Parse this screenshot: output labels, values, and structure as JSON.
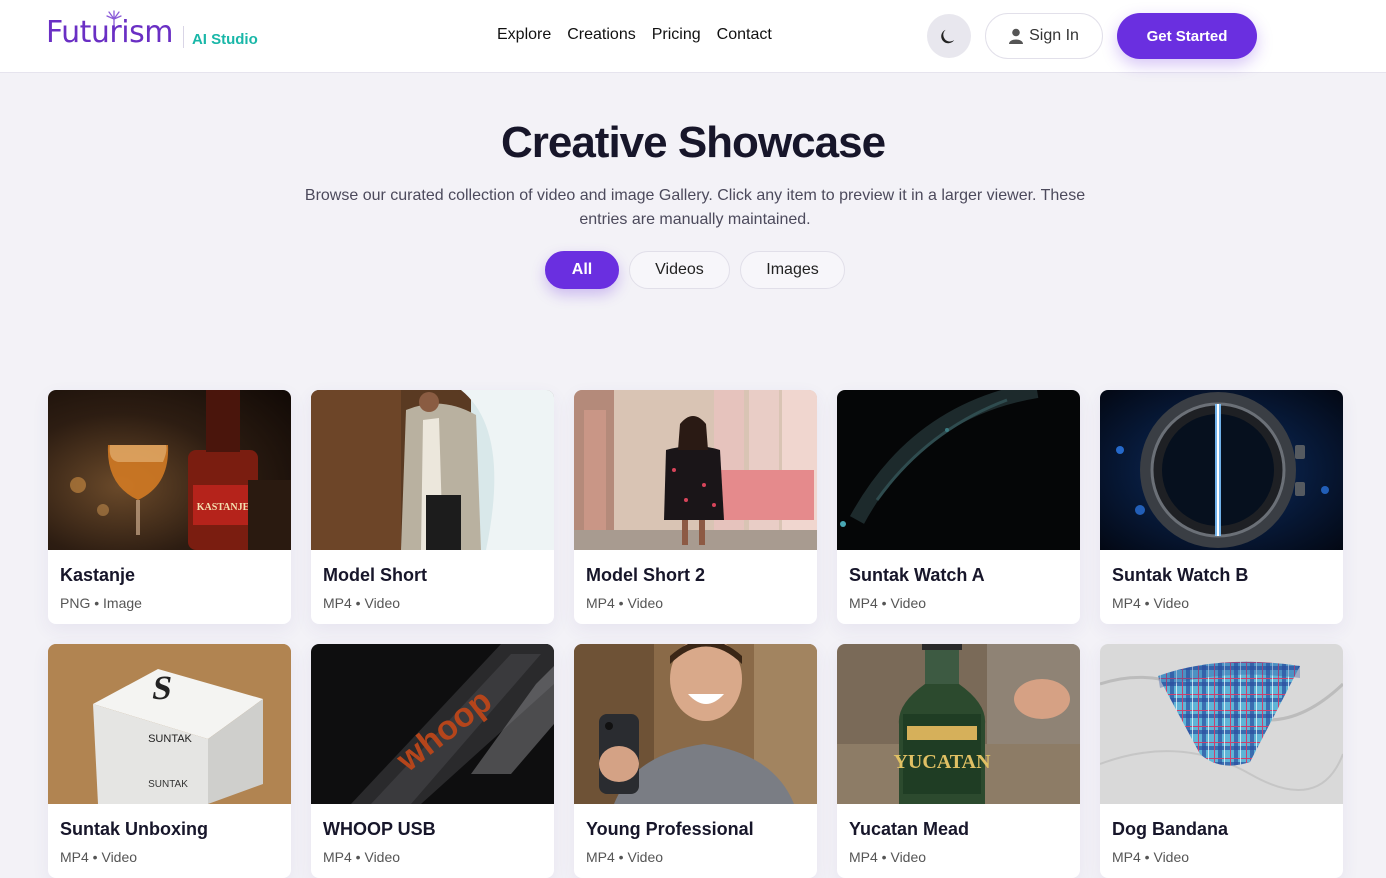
{
  "brand": {
    "name": "Futurism",
    "sub": "AI Studio"
  },
  "nav": [
    "Explore",
    "Creations",
    "Pricing",
    "Contact"
  ],
  "header": {
    "signin": "Sign In",
    "cta": "Get Started"
  },
  "hero": {
    "title": "Creative Showcase",
    "subtitle": "Browse our curated collection of video and image Gallery. Click any item to preview it in a larger viewer. These entries are manually maintained."
  },
  "filters": [
    "All",
    "Videos",
    "Images"
  ],
  "colors": {
    "accent": "#6a2fe0",
    "brand": "#6a2fc4",
    "sub": "#19b7a8"
  },
  "items": [
    {
      "title": "Kastanje",
      "format": "PNG",
      "kind": "Image"
    },
    {
      "title": "Model Short",
      "format": "MP4",
      "kind": "Video"
    },
    {
      "title": "Model Short 2",
      "format": "MP4",
      "kind": "Video"
    },
    {
      "title": "Suntak Watch A",
      "format": "MP4",
      "kind": "Video"
    },
    {
      "title": "Suntak Watch B",
      "format": "MP4",
      "kind": "Video"
    },
    {
      "title": "Suntak Unboxing",
      "format": "MP4",
      "kind": "Video"
    },
    {
      "title": "WHOOP USB",
      "format": "MP4",
      "kind": "Video"
    },
    {
      "title": "Young Professional",
      "format": "MP4",
      "kind": "Video"
    },
    {
      "title": "Yucatan Mead",
      "format": "MP4",
      "kind": "Video"
    },
    {
      "title": "Dog Bandana",
      "format": "MP4",
      "kind": "Video"
    }
  ],
  "thumb_text": {
    "kastanje": "KASTANJE",
    "suntak": "SUNTAK",
    "whoop": "whoop",
    "yucatan": "YUCATAN"
  }
}
